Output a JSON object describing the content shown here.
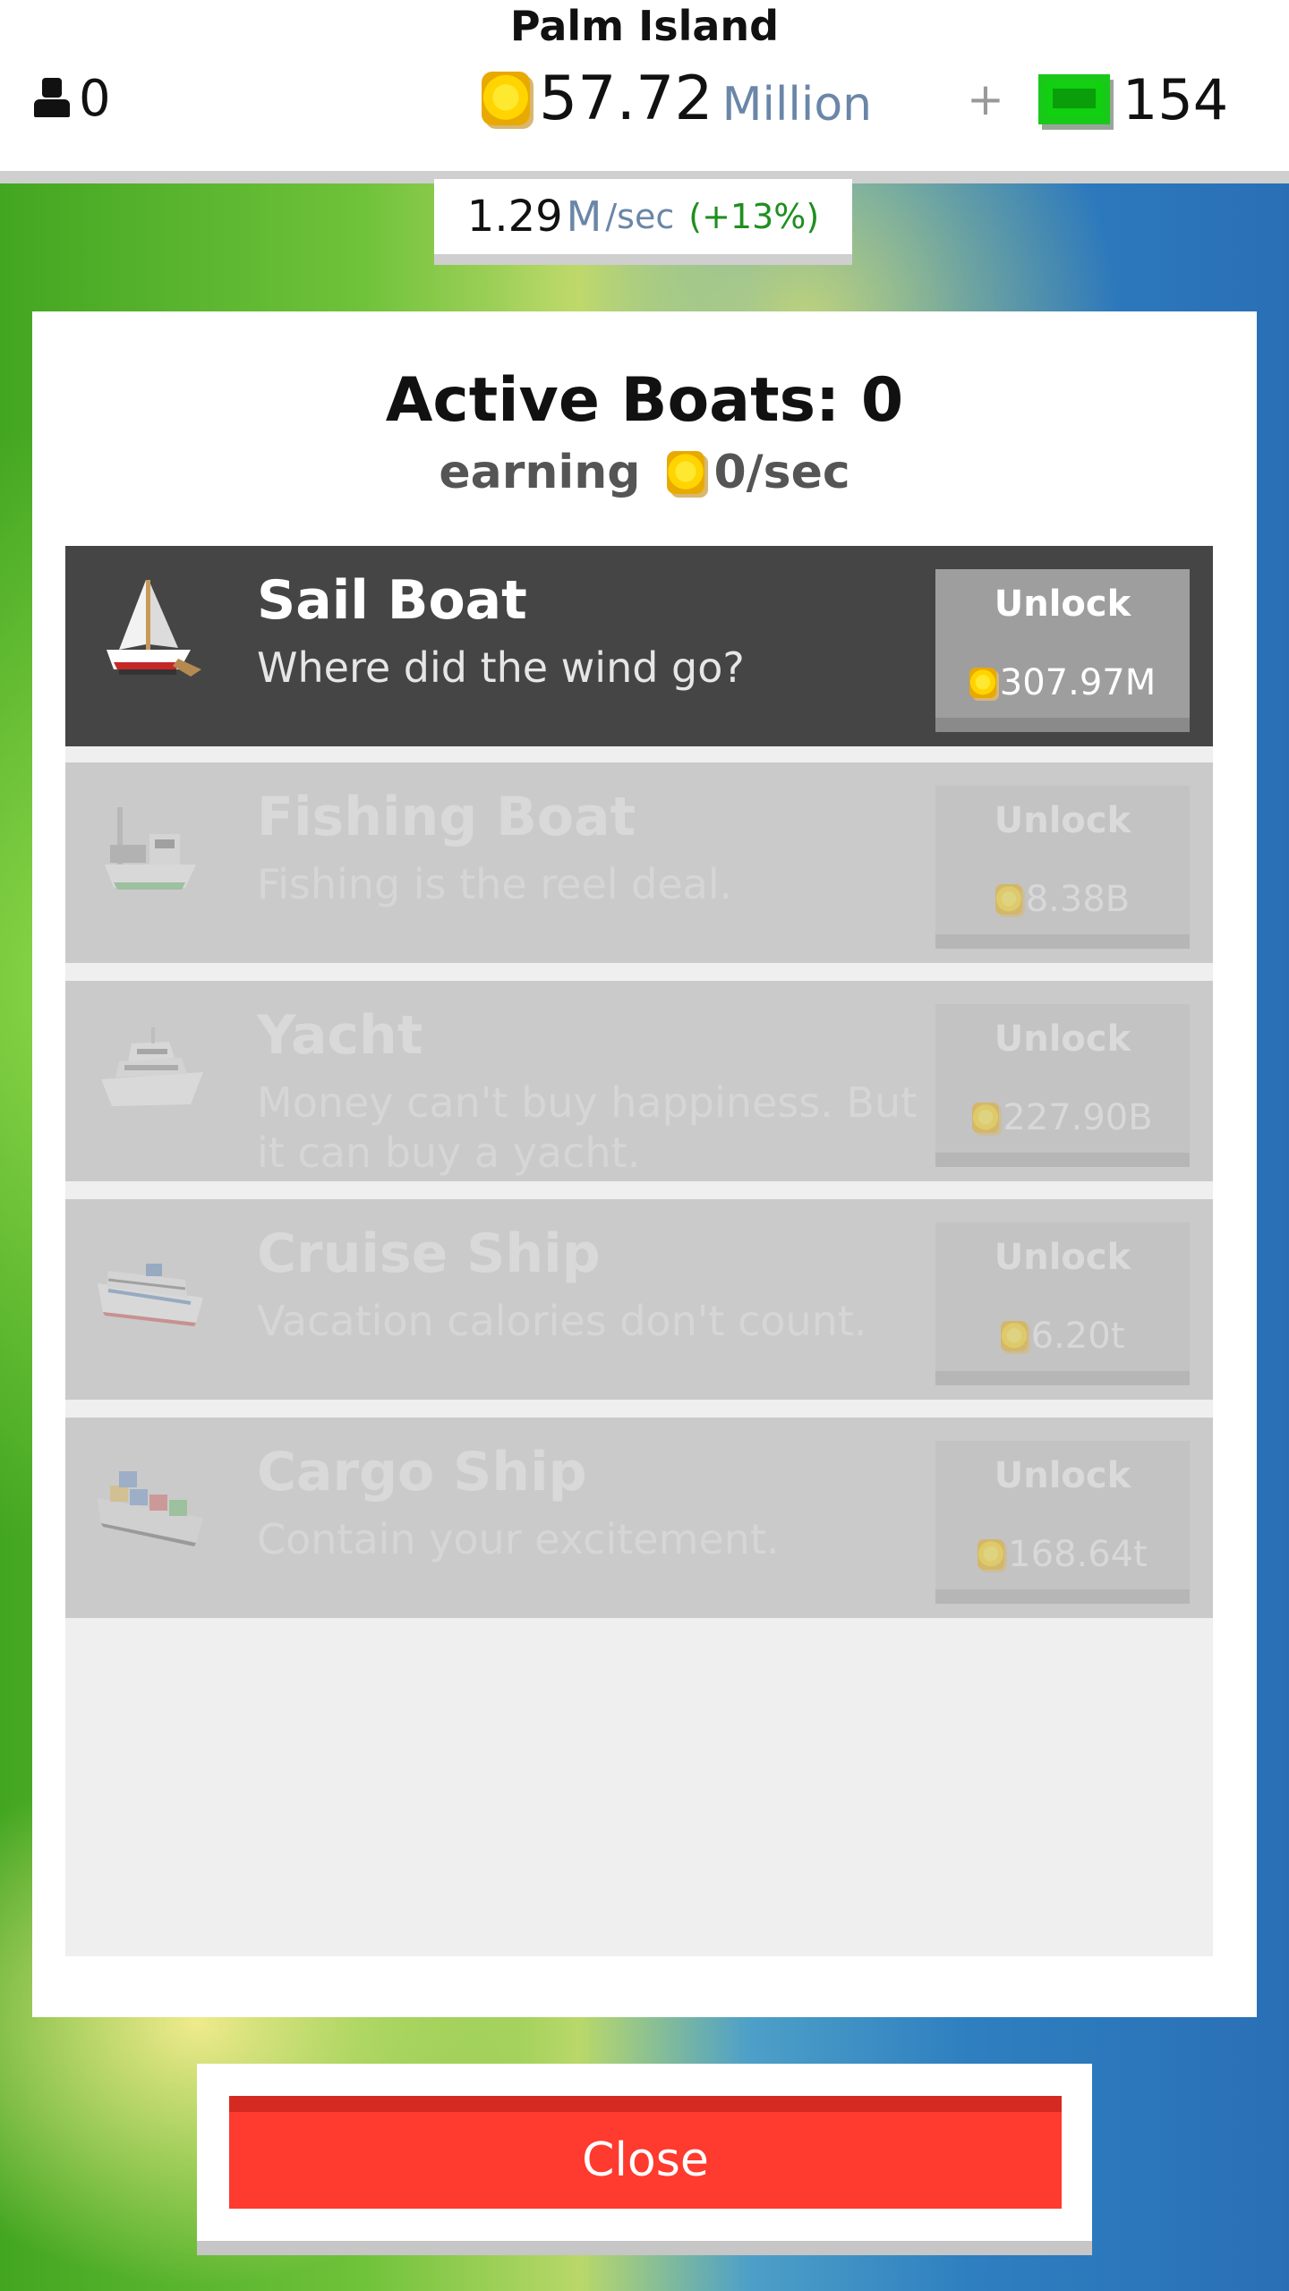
{
  "header": {
    "island_name": "Palm Island",
    "workers": "0",
    "money_value": "57.72",
    "money_unit": "Million",
    "plus": "+",
    "gems": "154",
    "rate_value": "1.29",
    "rate_unit": "M",
    "rate_per": "/sec",
    "rate_bonus": "(+13%)"
  },
  "panel": {
    "title": "Active Boats: 0",
    "earning_label": "earning",
    "earning_value": "0/sec",
    "boats": [
      {
        "name": "Sail Boat",
        "desc": "Where did the wind go?",
        "unlock_label": "Unlock",
        "price": "307.97M",
        "state": "active",
        "icon": "sail-boat-icon"
      },
      {
        "name": "Fishing Boat",
        "desc": "Fishing is the reel deal.",
        "unlock_label": "Unlock",
        "price": "8.38B",
        "state": "locked",
        "icon": "fishing-boat-icon"
      },
      {
        "name": "Yacht",
        "desc": "Money can't buy happiness. But it can buy a yacht.",
        "unlock_label": "Unlock",
        "price": "227.90B",
        "state": "locked",
        "icon": "yacht-icon"
      },
      {
        "name": "Cruise Ship",
        "desc": "Vacation calories don't count.",
        "unlock_label": "Unlock",
        "price": "6.20t",
        "state": "locked",
        "icon": "cruise-ship-icon"
      },
      {
        "name": "Cargo Ship",
        "desc": "Contain your excitement.",
        "unlock_label": "Unlock",
        "price": "168.64t",
        "state": "locked",
        "icon": "cargo-ship-icon"
      }
    ]
  },
  "close_label": "Close",
  "colors": {
    "close_button": "#ff3a2e",
    "active_row": "#454545",
    "locked_row": "#cacaca",
    "coin": "#ffd400",
    "gem": "#10d010",
    "rate_bonus": "#1f8f1f"
  }
}
